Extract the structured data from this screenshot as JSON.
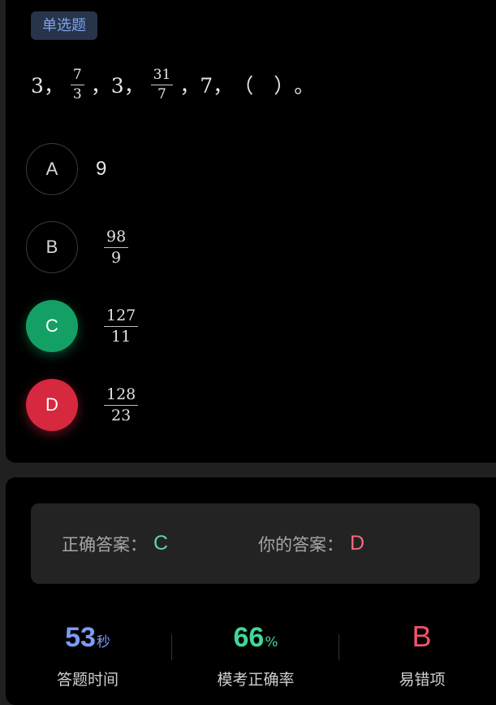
{
  "question": {
    "type_tag": "单选题",
    "stem": {
      "t1": "3，",
      "f1_num": "7",
      "f1_den": "3",
      "t2": "，3，",
      "f2_num": "31",
      "f2_den": "7",
      "t3": "，7，",
      "blank": "（　）",
      "end": "。"
    },
    "options": [
      {
        "letter": "A",
        "value": "9"
      },
      {
        "letter": "B",
        "num": "98",
        "den": "9"
      },
      {
        "letter": "C",
        "num": "127",
        "den": "11",
        "state": "correct"
      },
      {
        "letter": "D",
        "num": "128",
        "den": "23",
        "state": "wrong"
      }
    ]
  },
  "result": {
    "correct_label": "正确答案：",
    "correct_value": "C",
    "yours_label": "你的答案：",
    "yours_value": "D"
  },
  "stats": [
    {
      "value": "53",
      "unit": "秒",
      "caption": "答题时间"
    },
    {
      "value": "66",
      "unit": "%",
      "caption": "模考正确率"
    },
    {
      "value": "B",
      "unit": "",
      "caption": "易错项"
    }
  ],
  "colors": {
    "correct": "#14a064",
    "wrong": "#d6283e",
    "correct_text": "#5fd3a2",
    "wrong_text": "#f06a7a",
    "time": "#7b9cf4",
    "rate": "#3fd79a",
    "error_option": "#f0546a",
    "tag_text": "#7ea2ea"
  }
}
